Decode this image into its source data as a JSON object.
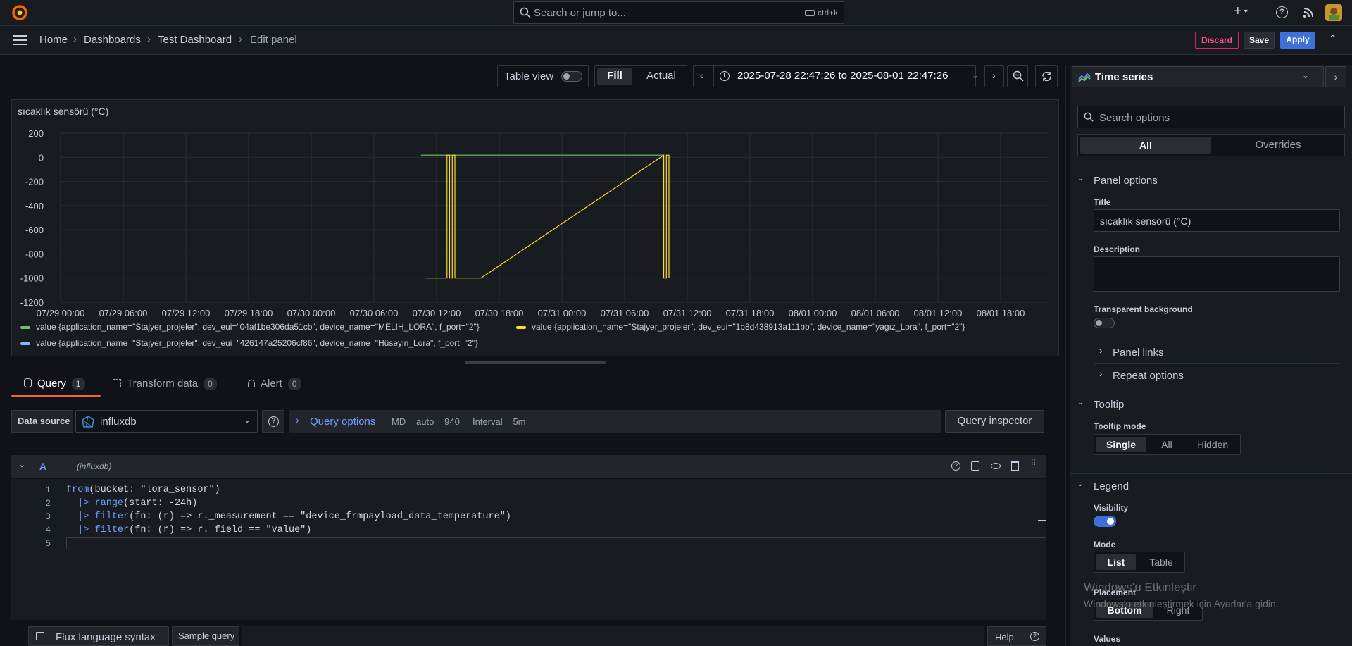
{
  "topbar": {
    "search_placeholder": "Search or jump to...",
    "search_shortcut": "ctrl+k",
    "plus": "+"
  },
  "breadcrumb": {
    "items": [
      "Home",
      "Dashboards",
      "Test Dashboard",
      "Edit panel"
    ]
  },
  "actions": {
    "discard": "Discard",
    "save": "Save",
    "apply": "Apply"
  },
  "toolbar": {
    "table_view": "Table view",
    "fill": "Fill",
    "actual": "Actual",
    "time_range": "2025-07-28 22:47:26 to 2025-08-01 22:47:26"
  },
  "panel": {
    "title": "sıcaklık sensörü (°C)"
  },
  "chart_data": {
    "type": "line",
    "title": "sıcaklık sensörü (°C)",
    "y_ticks": [
      "200",
      "0",
      "-200",
      "-400",
      "-600",
      "-800",
      "-1000",
      "-1200"
    ],
    "x_ticks": [
      "07/29 00:00",
      "07/29 06:00",
      "07/29 12:00",
      "07/29 18:00",
      "07/30 00:00",
      "07/30 06:00",
      "07/30 12:00",
      "07/30 18:00",
      "07/31 00:00",
      "07/31 06:00",
      "07/31 12:00",
      "07/31 18:00",
      "08/01 00:00",
      "08/01 06:00",
      "08/01 12:00",
      "08/01 18:00"
    ],
    "ylim": [
      -1200,
      200
    ],
    "series": [
      {
        "name": "value {application_name=\"Stajyer_projeler\", dev_eui=\"04af1be306da51cb\", device_name=\"MELIH_LORA\", f_port=\"2\"}",
        "color": "#73bf69",
        "points": [
          [
            "07/30 10:30",
            18
          ],
          [
            "07/31 09:45",
            18
          ]
        ]
      },
      {
        "name": "value {application_name=\"Stajyer_projeler\", dev_eui=\"1b8d438913a111bb\", device_name=\"yagız_Lora\", f_port=\"2\"}",
        "color": "#fade2a",
        "points": [
          [
            "07/30 11:00",
            -1000
          ],
          [
            "07/30 13:00",
            -1000
          ],
          [
            "07/30 13:00",
            18
          ],
          [
            "07/30 13:15",
            18
          ],
          [
            "07/30 13:15",
            -1000
          ],
          [
            "07/30 13:30",
            -1000
          ],
          [
            "07/30 13:30",
            18
          ],
          [
            "07/30 13:45",
            18
          ],
          [
            "07/30 13:45",
            -1000
          ],
          [
            "07/30 16:15",
            -1000
          ],
          [
            "07/31 09:45",
            18
          ],
          [
            "07/31 09:45",
            -1000
          ],
          [
            "07/31 10:00",
            -1000
          ],
          [
            "07/31 10:00",
            18
          ],
          [
            "07/31 10:15",
            18
          ],
          [
            "07/31 10:15",
            -1000
          ]
        ]
      },
      {
        "name": "value {application_name=\"Stajyer_projeler\", dev_eui=\"426147a25206cf86\", device_name=\"Hüseyin_Lora\", f_port=\"2\"}",
        "color": "#8ab8ff",
        "points": []
      }
    ]
  },
  "tabs": [
    {
      "label": "Query",
      "count": "1"
    },
    {
      "label": "Transform data",
      "count": "0"
    },
    {
      "label": "Alert",
      "count": "0"
    }
  ],
  "query": {
    "datasource_label": "Data source",
    "datasource": "influxdb",
    "options_label": "Query options",
    "md": "MD = auto = 940",
    "interval": "Interval = 5m",
    "inspector": "Query inspector",
    "ref": "A",
    "ref_ds": "(influxdb)"
  },
  "code": {
    "lines": [
      {
        "n": "1",
        "pre": "",
        "kw": "from",
        "rest": "(bucket: \"lora_sensor\")"
      },
      {
        "n": "2",
        "pre": "  |> ",
        "kw": "range",
        "rest": "(start: -24h)"
      },
      {
        "n": "3",
        "pre": "  |> ",
        "kw": "filter",
        "rest": "(fn: (r) => r._measurement == \"device_frmpayload_data_temperature\")"
      },
      {
        "n": "4",
        "pre": "  |> ",
        "kw": "filter",
        "rest": "(fn: (r) => r._field == \"value\")"
      },
      {
        "n": "5",
        "pre": "",
        "kw": "",
        "rest": ""
      }
    ]
  },
  "bottom": {
    "flux": "Flux language syntax",
    "sample": "Sample query",
    "help": "Help"
  },
  "right": {
    "viz": "Time series",
    "search_placeholder": "Search options",
    "all": "All",
    "overrides": "Overrides",
    "panel_options": "Panel options",
    "title_label": "Title",
    "title_value": "sıcaklık sensörü (°C)",
    "description_label": "Description",
    "transparent_label": "Transparent background",
    "panel_links": "Panel links",
    "repeat_options": "Repeat options",
    "tooltip": "Tooltip",
    "tooltip_mode": "Tooltip mode",
    "tooltip_opts": [
      "Single",
      "All",
      "Hidden"
    ],
    "legend": "Legend",
    "visibility": "Visibility",
    "mode": "Mode",
    "mode_opts": [
      "List",
      "Table"
    ],
    "placement": "Placement",
    "placement_opts": [
      "Bottom",
      "Right"
    ],
    "values": "Values"
  },
  "watermark": {
    "title": "Windows'u Etkinleştir",
    "sub": "Windows'u etkinleştirmek için Ayarlar'a gidin."
  }
}
